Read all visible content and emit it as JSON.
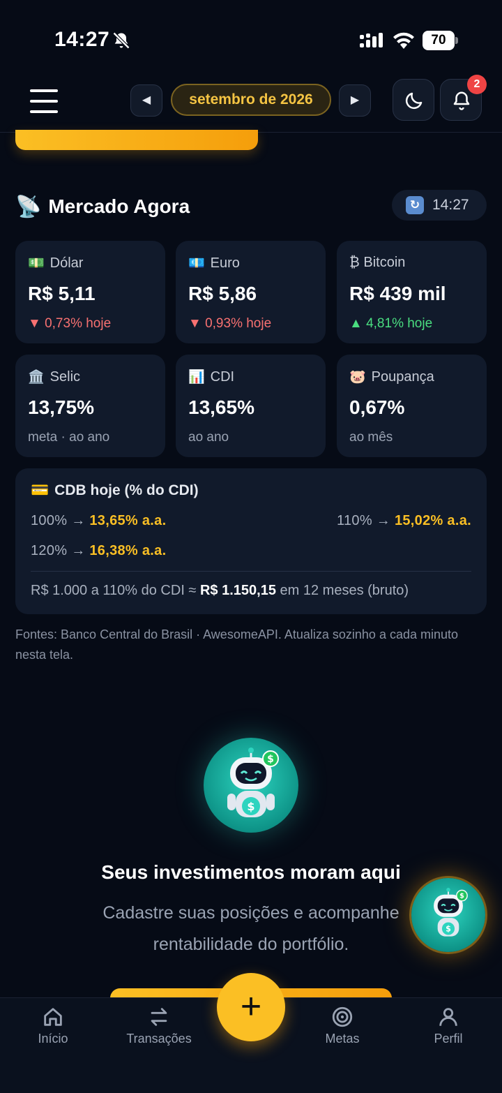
{
  "status_bar": {
    "time": "14:27",
    "battery": "70"
  },
  "header": {
    "month": "setembro de 2026",
    "prev_symbol": "◀",
    "next_symbol": "▶",
    "notification_count": "2"
  },
  "market": {
    "title": "Mercado Agora",
    "title_emoji": "📡",
    "updated_time": "14:27",
    "refresh_symbol": "↻",
    "cards": [
      {
        "emoji": "💵",
        "label": "Dólar",
        "value": "R$ 5,11",
        "sub": "▼ 0,73% hoje",
        "trend": "down"
      },
      {
        "emoji": "💶",
        "label": "Euro",
        "value": "R$ 5,86",
        "sub": "▼ 0,93% hoje",
        "trend": "down"
      },
      {
        "emoji": "",
        "label": "₿ Bitcoin",
        "value": "R$ 439 mil",
        "sub": "▲ 4,81% hoje",
        "trend": "up"
      },
      {
        "emoji": "🏛️",
        "label": "Selic",
        "value": "13,75%",
        "sub": "meta · ao ano",
        "trend": "none"
      },
      {
        "emoji": "📊",
        "label": "CDI",
        "value": "13,65%",
        "sub": "ao ano",
        "trend": "none"
      },
      {
        "emoji": "🐷",
        "label": "Poupança",
        "value": "0,67%",
        "sub": "ao mês",
        "trend": "none"
      }
    ],
    "cdb": {
      "emoji": "💳",
      "title": "CDB hoje (% do CDI)",
      "rows": [
        {
          "pct": "100% →",
          "rate": "13,65% a.a."
        },
        {
          "pct": "110% →",
          "rate": "15,02% a.a."
        },
        {
          "pct": "120% →",
          "rate": "16,38% a.a."
        }
      ],
      "example_prefix": "R$ 1.000 a 110% do CDI ≈",
      "example_value": "R$ 1.150,15",
      "example_suffix": "em 12 meses (bruto)"
    },
    "sources": "Fontes: Banco Central do Brasil · AwesomeAPI. Atualiza sozinho a cada minuto nesta tela."
  },
  "empty_state": {
    "title": "Seus investimentos moram aqui",
    "description": "Cadastre suas posições e acompanhe rentabilidade do portfólio."
  },
  "bottom_nav": {
    "items": [
      {
        "label": "Início",
        "icon": "home-icon"
      },
      {
        "label": "Transações",
        "icon": "transfer-icon"
      },
      {
        "label": "Metas",
        "icon": "target-icon"
      },
      {
        "label": "Perfil",
        "icon": "user-icon"
      }
    ],
    "add_symbol": "+"
  },
  "colors": {
    "background": "#060b16",
    "card": "#111a2b",
    "accent": "#fbbf24",
    "down": "#f87171",
    "up": "#4ade80",
    "badge": "#ef4444"
  }
}
